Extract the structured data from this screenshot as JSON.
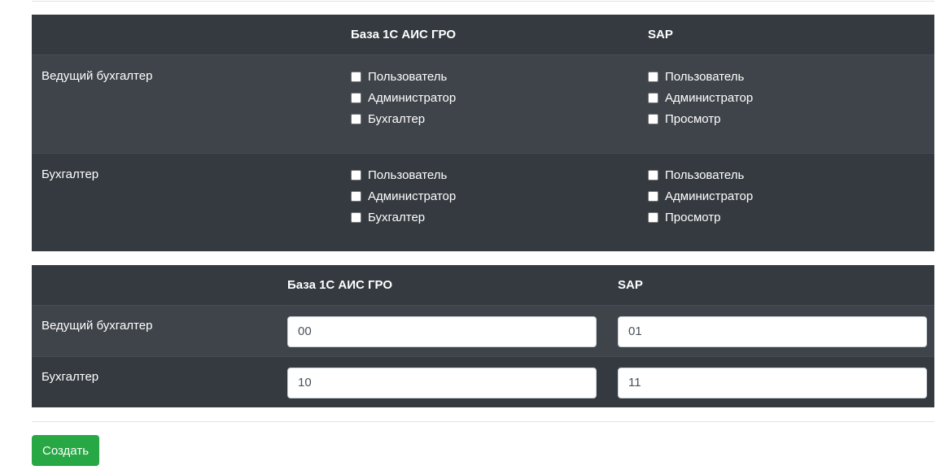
{
  "roles_table": {
    "headers": [
      "",
      "База 1С АИС ГРО",
      "SAP"
    ],
    "rows": [
      {
        "label": "Ведущий бухгалтер",
        "base1c": [
          "Пользователь",
          "Администратор",
          "Бухгалтер"
        ],
        "sap": [
          "Пользователь",
          "Администратор",
          "Просмотр"
        ]
      },
      {
        "label": "Бухгалтер",
        "base1c": [
          "Пользователь",
          "Администратор",
          "Бухгалтер"
        ],
        "sap": [
          "Пользователь",
          "Администратор",
          "Просмотр"
        ]
      }
    ]
  },
  "codes_table": {
    "headers": [
      "",
      "База 1С АИС ГРО",
      "SAP"
    ],
    "rows": [
      {
        "label": "Ведущий бухгалтер",
        "base1c_value": "00",
        "sap_value": "01"
      },
      {
        "label": "Бухгалтер",
        "base1c_value": "10",
        "sap_value": "11"
      }
    ]
  },
  "actions": {
    "create_label": "Создать"
  },
  "colors": {
    "table_bg": "#343a40",
    "row_stripe": "#3e444a",
    "button_green": "#28a745"
  }
}
